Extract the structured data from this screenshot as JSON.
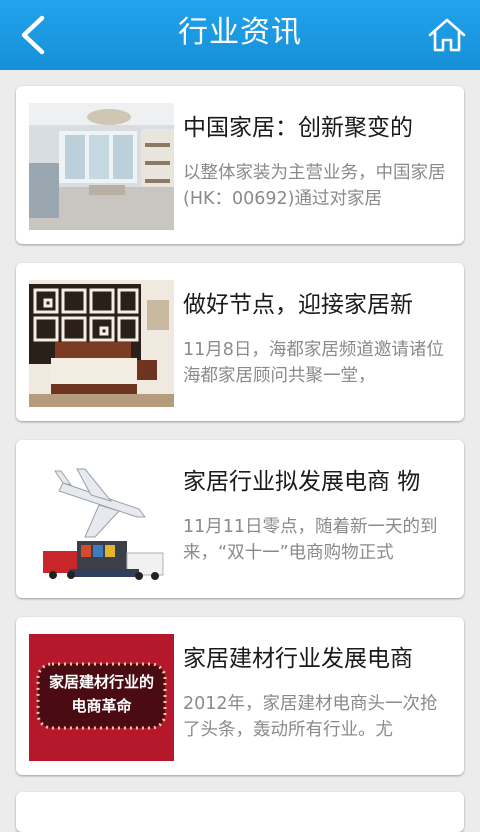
{
  "header": {
    "title": "行业资讯",
    "back_icon": "chevron-left-icon",
    "home_icon": "home-icon"
  },
  "colors": {
    "header_bg": "#1b9be4",
    "card_bg": "#ffffff",
    "title_text": "#1a1a1a",
    "desc_text": "#8a8a8a"
  },
  "articles": [
    {
      "title": "中国家居：创新聚变的",
      "desc": "以整体家装为主营业务，中国家居(HK：00692)通过对家居",
      "image": "living-room-photo"
    },
    {
      "title": "做好节点，迎接家居新",
      "desc": "11月8日，海都家居频道邀请诸位海都家居顾问共聚一堂，",
      "image": "bedroom-photo"
    },
    {
      "title": "家居行业拟发展电商 物",
      "desc": "11月11日零点，随着新一天的到来，“双十一”电商购物正式",
      "image": "logistics-photo"
    },
    {
      "title": "家居建材行业发展电商",
      "desc": "2012年，家居建材电商头一次抢了头条，轰动所有行业。尤",
      "image": "banner-graphic",
      "image_text": [
        "家居建材行业的",
        "电商革命"
      ]
    }
  ]
}
